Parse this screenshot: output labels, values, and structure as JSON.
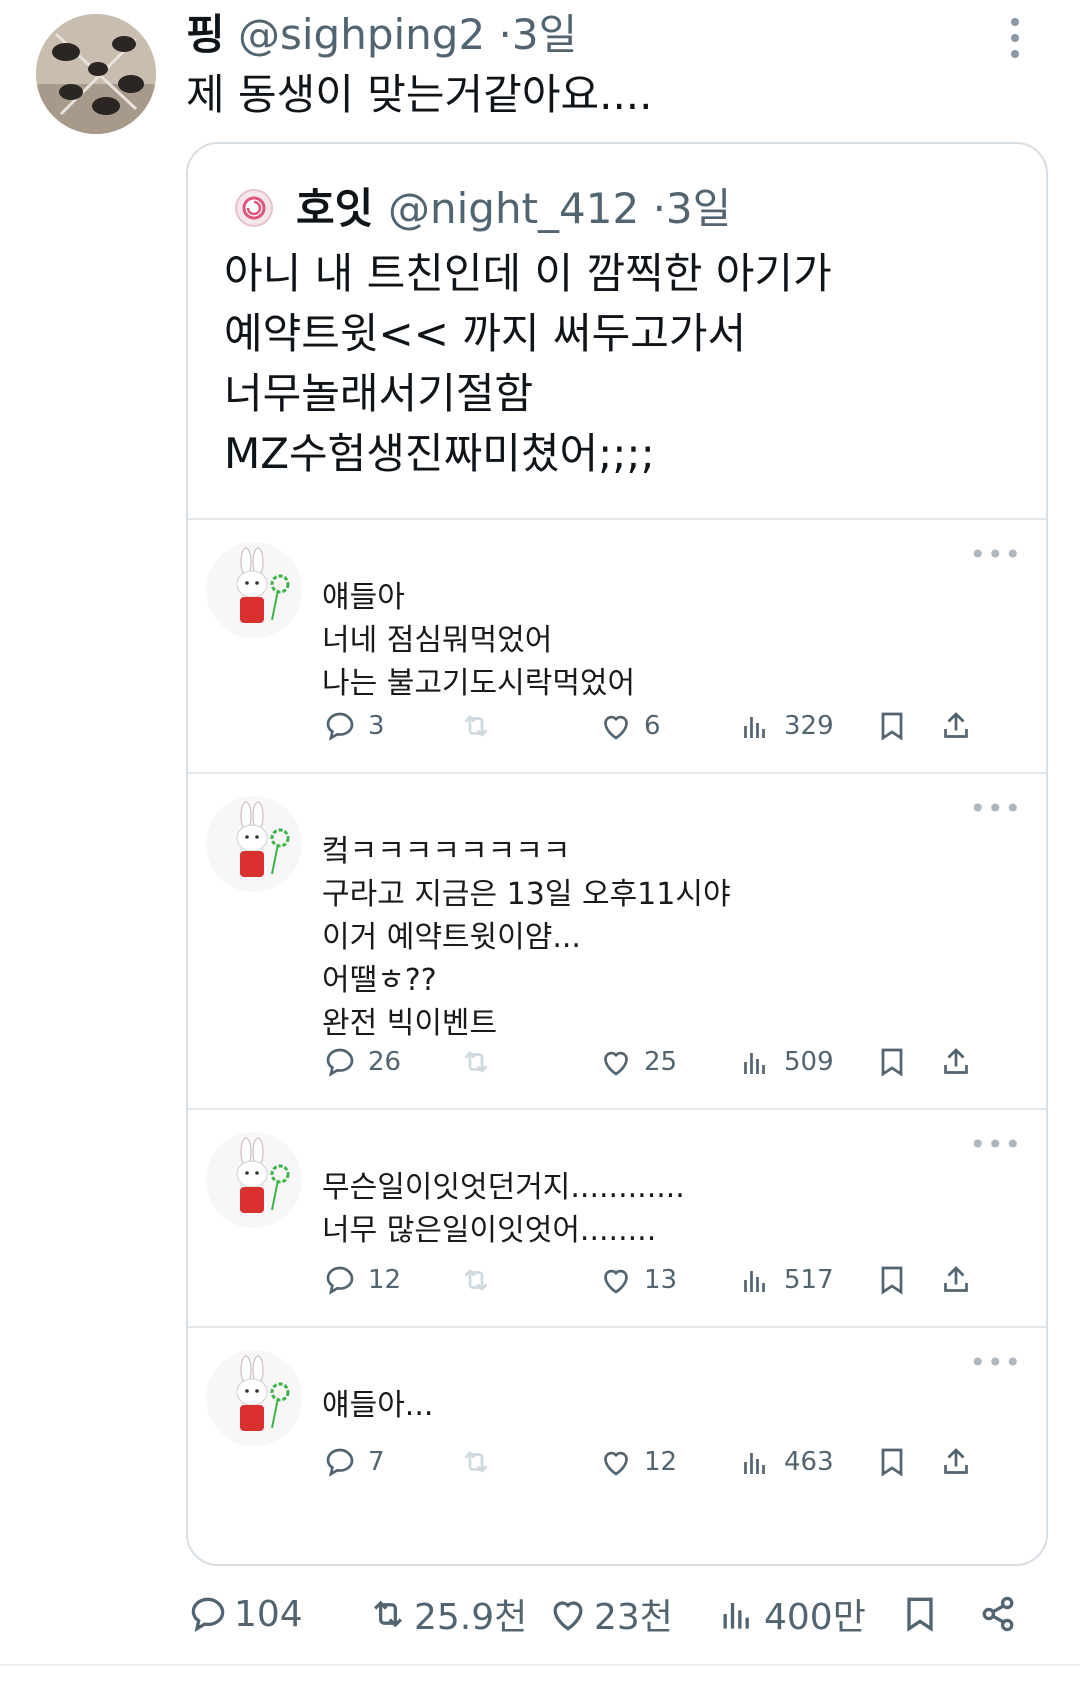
{
  "tweet": {
    "author_name": "핑",
    "author_handle": "@sighping2",
    "separator": "·",
    "time": "3일",
    "text": "제 동생이 맞는거같아요....",
    "stats": {
      "replies": "104",
      "retweets": "25.9천",
      "likes": "23천",
      "views": "400만"
    }
  },
  "quoted": {
    "author_name": "호잇",
    "author_handle": "@night_412",
    "separator": "·",
    "time": "3일",
    "lines": [
      "아니 내 트친인데 이 깜찍한 아기가",
      "예약트윗<< 까지 써두고가서",
      "너무놀래서기절함",
      "MZ수험생진짜미쳤어;;;;"
    ],
    "replies": [
      {
        "lines": [
          "얘들아",
          "너네 점심뭐먹었어",
          "나는 불고기도시락먹었어"
        ],
        "replies": "3",
        "retweets": "",
        "likes": "6",
        "views": "329"
      },
      {
        "lines": [
          "컼ㅋㅋㅋㅋㅋㅋㅋㅋ",
          "구라고 지금은 13일 오후11시야",
          "이거 예약트윗이얌...",
          "어땔ㅎ??",
          "완전 빅이벤트"
        ],
        "replies": "26",
        "retweets": "",
        "likes": "25",
        "views": "509"
      },
      {
        "lines": [
          "무슨일이잇엇던거지............",
          "너무 많은일이잇엇어........"
        ],
        "replies": "12",
        "retweets": "",
        "likes": "13",
        "views": "517"
      },
      {
        "lines": [
          "얘들아..."
        ],
        "replies": "7",
        "retweets": "",
        "likes": "12",
        "views": "463"
      }
    ]
  },
  "colors": {
    "text": "#0f1419",
    "muted": "#536471",
    "border": "#d6dde3",
    "bunny_overall": "#d9302f",
    "clover": "#3fb24a"
  },
  "icons": [
    "more-vertical-icon",
    "reply-icon",
    "retweet-icon",
    "like-icon",
    "views-icon",
    "bookmark-icon",
    "share-icon"
  ]
}
